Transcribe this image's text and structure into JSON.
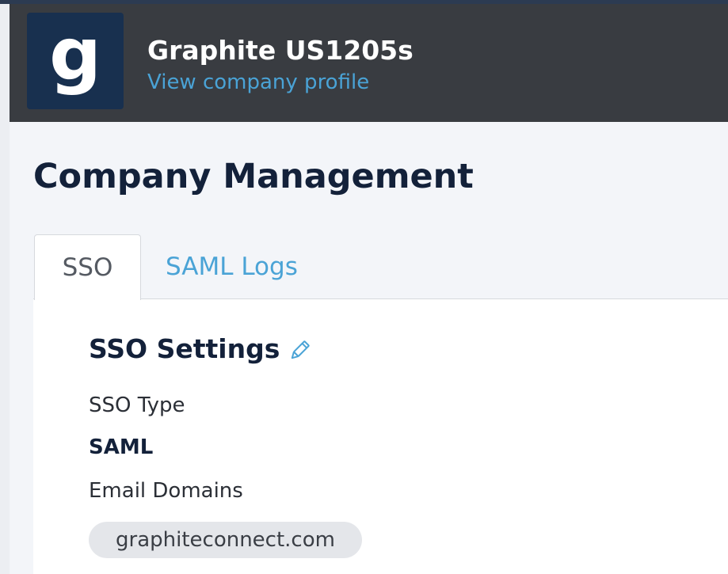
{
  "header": {
    "logo_letter": "g",
    "company_name": "Graphite US1205s",
    "profile_link": "View company profile"
  },
  "page": {
    "title": "Company Management"
  },
  "tabs": [
    {
      "label": "SSO",
      "active": true
    },
    {
      "label": "SAML Logs",
      "active": false
    }
  ],
  "sso_settings": {
    "title": "SSO Settings",
    "edit_icon": "pencil-icon",
    "sso_type_label": "SSO Type",
    "sso_type_value": "SAML",
    "email_domains_label": "Email Domains",
    "email_domains": [
      "graphiteconnect.com"
    ]
  },
  "colors": {
    "header_bg": "#393c41",
    "logo_bg": "#18304f",
    "link": "#4aa3d6",
    "title": "#13213a",
    "chip_bg": "#e4e6ea"
  }
}
